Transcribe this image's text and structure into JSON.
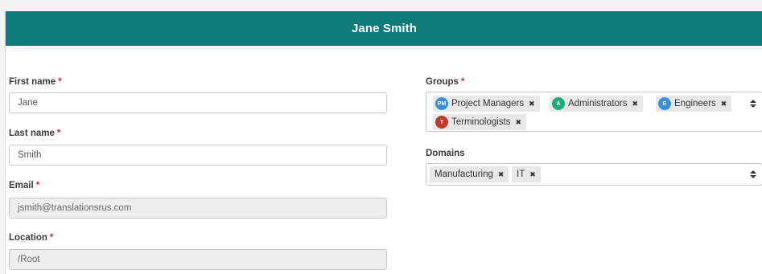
{
  "header": {
    "title": "Jane Smith"
  },
  "required_marker": "*",
  "fields": {
    "first_name": {
      "label": "First name",
      "value": "Jane"
    },
    "last_name": {
      "label": "Last name",
      "value": "Smith"
    },
    "email": {
      "label": "Email",
      "value": "jsmith@translationsrus.com"
    },
    "location": {
      "label": "Location",
      "value": "/Root"
    }
  },
  "groups": {
    "label": "Groups",
    "chips": [
      {
        "initials": "PM",
        "name": "Project Managers",
        "color": "#3b8fd6"
      },
      {
        "initials": "A",
        "name": "Administrators",
        "color": "#1fa97a"
      },
      {
        "initials": "E",
        "name": "Engineers",
        "color": "#3b8fd6"
      },
      {
        "initials": "T",
        "name": "Terminologists",
        "color": "#c0392b"
      }
    ]
  },
  "domains": {
    "label": "Domains",
    "chips": [
      {
        "name": "Manufacturing"
      },
      {
        "name": "IT"
      }
    ]
  },
  "colors": {
    "header_bg": "#0e7a7a",
    "required": "#d9282f"
  }
}
